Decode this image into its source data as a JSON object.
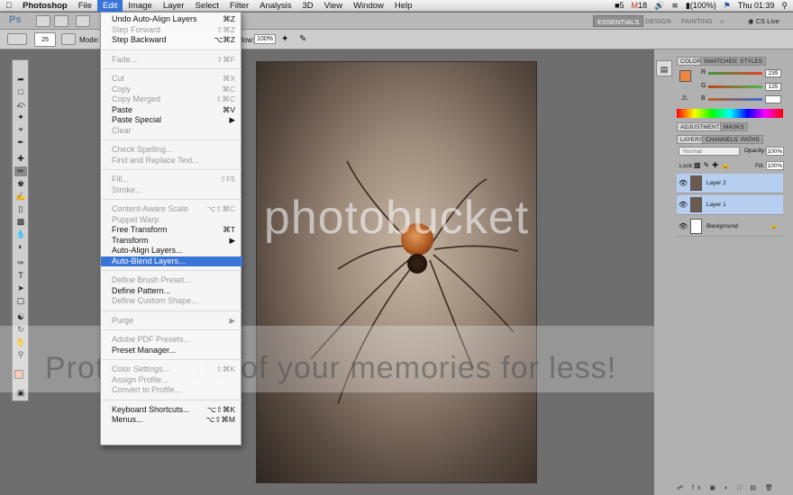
{
  "menubar": {
    "apple": "",
    "app": "Photoshop",
    "items": [
      "File",
      "Edit",
      "Image",
      "Layer",
      "Select",
      "Filter",
      "Analysis",
      "3D",
      "View",
      "Window",
      "Help"
    ],
    "status": {
      "adobe_count": "5",
      "mail_count": "18",
      "battery": "(100%)",
      "clock": "Thu 01:39"
    }
  },
  "appbar": {
    "ps_logo": "Ps",
    "workspaces": [
      "ESSENTIALS",
      "DESIGN",
      "PAINTING"
    ],
    "cs_live": "CS Live"
  },
  "options": {
    "mode_label": "Mode:",
    "brush_size": "25",
    "flow_label": "low:",
    "flow_value": "100%"
  },
  "edit_menu": [
    {
      "label": "Undo Auto-Align Layers",
      "shortcut": "⌘Z",
      "enabled": true
    },
    {
      "label": "Step Forward",
      "shortcut": "⇧⌘Z",
      "enabled": false
    },
    {
      "label": "Step Backward",
      "shortcut": "⌥⌘Z",
      "enabled": true
    },
    {
      "sep": true
    },
    {
      "label": "Fade...",
      "shortcut": "⇧⌘F",
      "enabled": false
    },
    {
      "sep": true
    },
    {
      "label": "Cut",
      "shortcut": "⌘X",
      "enabled": false
    },
    {
      "label": "Copy",
      "shortcut": "⌘C",
      "enabled": false
    },
    {
      "label": "Copy Merged",
      "shortcut": "⇧⌘C",
      "enabled": false
    },
    {
      "label": "Paste",
      "shortcut": "⌘V",
      "enabled": true
    },
    {
      "label": "Paste Special",
      "shortcut": "▶",
      "enabled": true
    },
    {
      "label": "Clear",
      "shortcut": "",
      "enabled": false
    },
    {
      "sep": true
    },
    {
      "label": "Check Spelling...",
      "shortcut": "",
      "enabled": false
    },
    {
      "label": "Find and Replace Text...",
      "shortcut": "",
      "enabled": false
    },
    {
      "sep": true
    },
    {
      "label": "Fill...",
      "shortcut": "⇧F5",
      "enabled": false
    },
    {
      "label": "Stroke...",
      "shortcut": "",
      "enabled": false
    },
    {
      "sep": true
    },
    {
      "label": "Content-Aware Scale",
      "shortcut": "⌥⇧⌘C",
      "enabled": false
    },
    {
      "label": "Puppet Warp",
      "shortcut": "",
      "enabled": false
    },
    {
      "label": "Free Transform",
      "shortcut": "⌘T",
      "enabled": true
    },
    {
      "label": "Transform",
      "shortcut": "▶",
      "enabled": true
    },
    {
      "label": "Auto-Align Layers...",
      "shortcut": "",
      "enabled": true
    },
    {
      "label": "Auto-Blend Layers...",
      "shortcut": "",
      "enabled": true,
      "highlighted": true
    },
    {
      "sep": true
    },
    {
      "label": "Define Brush Preset...",
      "shortcut": "",
      "enabled": false
    },
    {
      "label": "Define Pattern...",
      "shortcut": "",
      "enabled": true
    },
    {
      "label": "Define Custom Shape...",
      "shortcut": "",
      "enabled": false
    },
    {
      "sep": true
    },
    {
      "label": "Purge",
      "shortcut": "▶",
      "enabled": false
    },
    {
      "sep": true
    },
    {
      "label": "Adobe PDF Presets...",
      "shortcut": "",
      "enabled": false
    },
    {
      "label": "Preset Manager...",
      "shortcut": "",
      "enabled": true
    },
    {
      "sep": true
    },
    {
      "label": "Color Settings...",
      "shortcut": "⇧⌘K",
      "enabled": false
    },
    {
      "label": "Assign Profile...",
      "shortcut": "",
      "enabled": false
    },
    {
      "label": "Convert to Profile...",
      "shortcut": "",
      "enabled": false
    },
    {
      "sep": true
    },
    {
      "label": "Keyboard Shortcuts...",
      "shortcut": "⌥⇧⌘K",
      "enabled": true
    },
    {
      "label": "Menus...",
      "shortcut": "⌥⇧⌘M",
      "enabled": true
    }
  ],
  "color_panel": {
    "tabs": [
      "COLOR",
      "SWATCHES",
      "STYLES"
    ],
    "channels": [
      {
        "name": "R",
        "value": "239",
        "color": "#e8402a"
      },
      {
        "name": "G",
        "value": "135",
        "color": "#4bb84b"
      },
      {
        "name": "B",
        "value": "",
        "color": "#3a6ed8"
      }
    ],
    "foreground": "#ef8740"
  },
  "adjustments_panel": {
    "tabs": [
      "ADJUSTMENTS",
      "MASKS"
    ]
  },
  "layers_panel": {
    "tabs": [
      "LAYERS",
      "CHANNELS",
      "PATHS"
    ],
    "blend_mode": "Normal",
    "opacity_label": "Opacity:",
    "opacity": "100%",
    "lock_label": "Lock:",
    "fill_label": "Fill:",
    "fill": "100%",
    "layers": [
      {
        "name": "Layer 2",
        "selected": true
      },
      {
        "name": "Layer 1",
        "selected": true
      },
      {
        "name": "Background",
        "selected": false
      }
    ]
  },
  "watermark": {
    "line1": "photobucket",
    "line2": "Protect more of your memories for less!"
  }
}
